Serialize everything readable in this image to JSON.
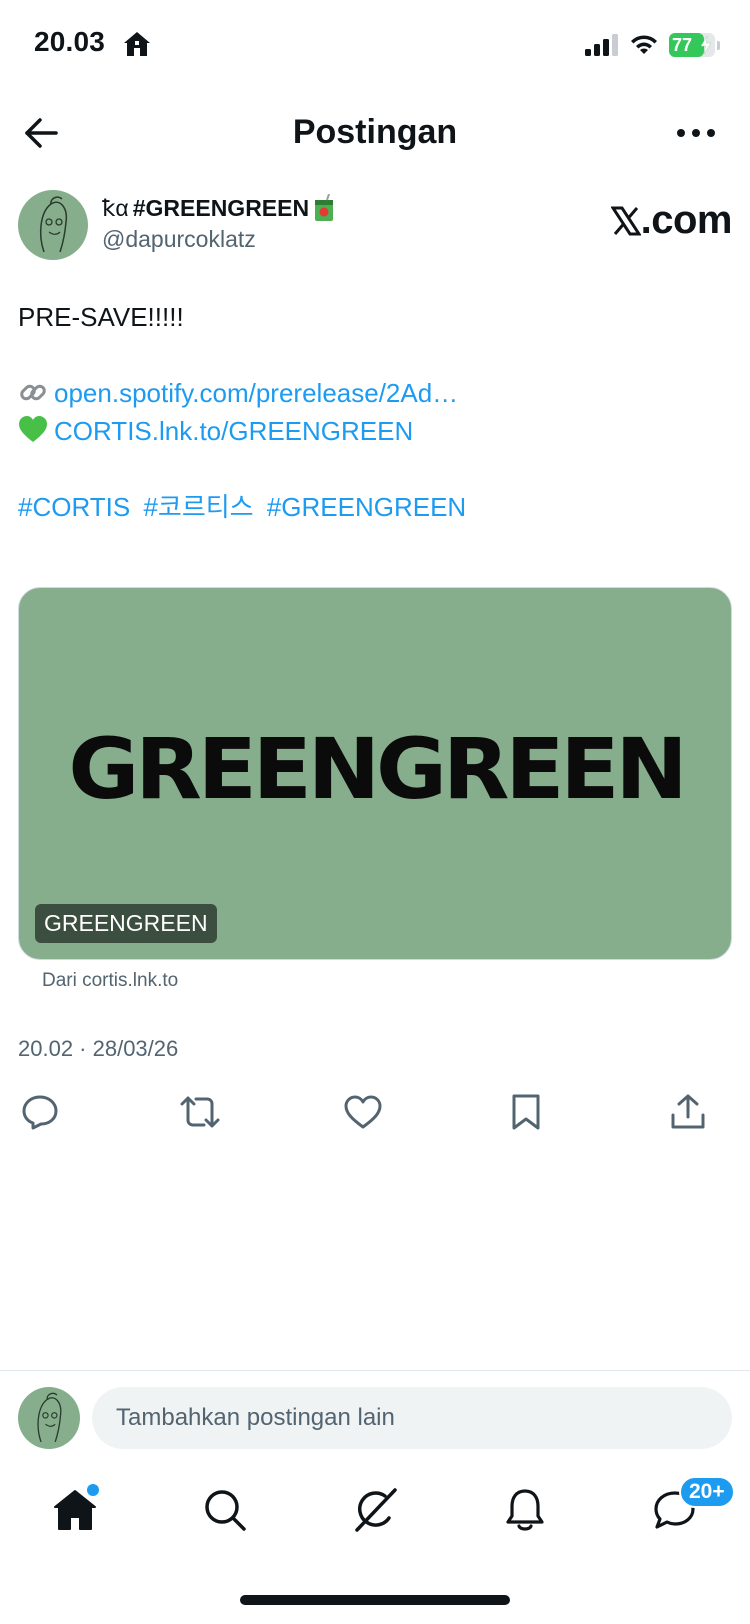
{
  "status_bar": {
    "time": "20.03",
    "battery_percent": "77",
    "battery_level": 0.77,
    "icons": [
      "home-icon",
      "signal-icon",
      "wifi-icon",
      "battery-icon"
    ]
  },
  "header": {
    "title": "Postingan",
    "back_icon": "arrow-left-icon",
    "more_icon": "more-horizontal-icon"
  },
  "author": {
    "display_prefix": "ꝁα",
    "display_name": "#GREENGREEN",
    "handle": "@dapurcoklatz",
    "source_logo_text": ".com"
  },
  "post": {
    "line1": "PRE-SAVE!!!!!",
    "link1": "open.spotify.com/prerelease/2Ad…",
    "link2": "CORTIS.lnk.to/GREENGREEN",
    "hashtags": [
      "#CORTIS",
      "#코르티스",
      "#GREENGREEN"
    ]
  },
  "card": {
    "image_text": "GREENGREEN",
    "badge": "GREENGREEN",
    "source": "Dari cortis.lnk.to",
    "bg_color": "#86ae8c"
  },
  "timestamp": "20.02 · 28/03/26",
  "actions": [
    "reply-icon",
    "repost-icon",
    "like-icon",
    "bookmark-icon",
    "share-icon"
  ],
  "composer": {
    "placeholder": "Tambahkan postingan lain"
  },
  "tabbar": {
    "items": [
      "home-icon",
      "search-icon",
      "grok-icon",
      "notifications-icon",
      "messages-icon"
    ],
    "messages_badge": "20+"
  },
  "colors": {
    "accent": "#1d9bf0",
    "text": "#0f1419",
    "secondary": "#536471"
  }
}
